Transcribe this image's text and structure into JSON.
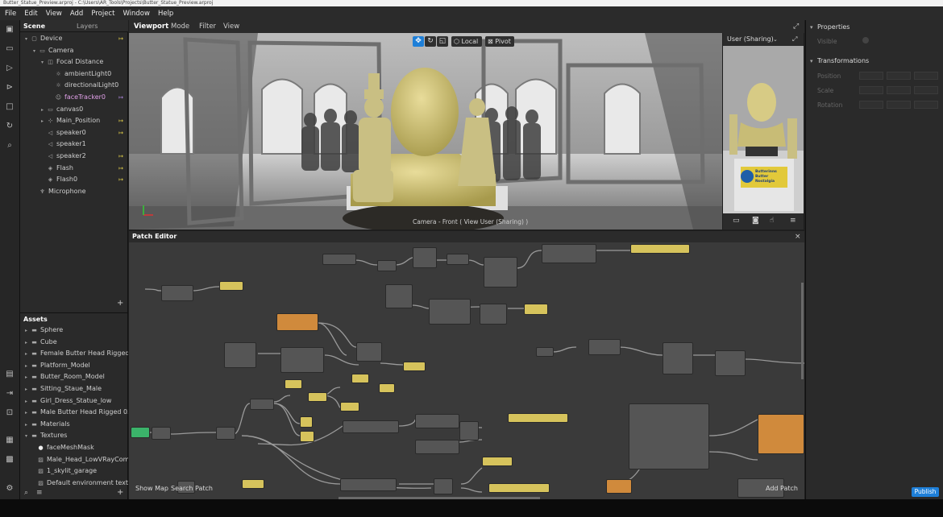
{
  "title_bar": "Butter_Statue_Preview.arproj - C:\\Users\\AR_Tools\\Projects\\Butter_Statue_Preview.arproj",
  "menu": [
    "File",
    "Edit",
    "View",
    "Add",
    "Project",
    "Window",
    "Help"
  ],
  "scene": {
    "tabs": [
      "Scene",
      "Layers"
    ],
    "items": [
      {
        "label": "Device",
        "indent": 0,
        "caret": "▾",
        "icon": "▢",
        "flag": "↦"
      },
      {
        "label": "Camera",
        "indent": 1,
        "caret": "▾",
        "icon": "▭",
        "flag": ""
      },
      {
        "label": "Focal Distance",
        "indent": 2,
        "caret": "▾",
        "icon": "◫",
        "flag": ""
      },
      {
        "label": "ambientLight0",
        "indent": 3,
        "caret": "",
        "icon": "☼",
        "flag": ""
      },
      {
        "label": "directionalLight0",
        "indent": 3,
        "caret": "",
        "icon": "☼",
        "flag": ""
      },
      {
        "label": "faceTracker0",
        "indent": 3,
        "caret": "",
        "icon": "☺",
        "flag": "↦"
      },
      {
        "label": "canvas0",
        "indent": 2,
        "caret": "▸",
        "icon": "▭",
        "flag": ""
      },
      {
        "label": "Main_Position",
        "indent": 2,
        "caret": "▸",
        "icon": "⊹",
        "flag": "↦"
      },
      {
        "label": "speaker0",
        "indent": 2,
        "caret": "",
        "icon": "◁",
        "flag": "↦"
      },
      {
        "label": "speaker1",
        "indent": 2,
        "caret": "",
        "icon": "◁",
        "flag": ""
      },
      {
        "label": "speaker2",
        "indent": 2,
        "caret": "",
        "icon": "◁",
        "flag": "↦"
      },
      {
        "label": "Flash",
        "indent": 2,
        "caret": "",
        "icon": "◈",
        "flag": "↦"
      },
      {
        "label": "Flash0",
        "indent": 2,
        "caret": "",
        "icon": "◈",
        "flag": "↦"
      },
      {
        "label": "Microphone",
        "indent": 1,
        "caret": "",
        "icon": "♆",
        "flag": ""
      }
    ],
    "add_symbol": "+"
  },
  "assets": {
    "header": "Assets",
    "items": [
      {
        "label": "Sphere",
        "indent": 0,
        "caret": "▸",
        "icon": "▬"
      },
      {
        "label": "Cube",
        "indent": 0,
        "caret": "▸",
        "icon": "▬"
      },
      {
        "label": "Female Butter Head Rigged...",
        "indent": 0,
        "caret": "▸",
        "icon": "▬"
      },
      {
        "label": "Platform_Model",
        "indent": 0,
        "caret": "▸",
        "icon": "▬"
      },
      {
        "label": "Butter_Room_Model",
        "indent": 0,
        "caret": "▸",
        "icon": "▬"
      },
      {
        "label": "Sitting_Staue_Male",
        "indent": 0,
        "caret": "▸",
        "icon": "▬"
      },
      {
        "label": "Girl_Dress_Statue_low",
        "indent": 0,
        "caret": "▸",
        "icon": "▬"
      },
      {
        "label": "Male Butter Head Rigged 03",
        "indent": 0,
        "caret": "▸",
        "icon": "▬"
      },
      {
        "label": "Materials",
        "indent": 0,
        "caret": "▸",
        "icon": ""
      },
      {
        "label": "Textures",
        "indent": 0,
        "caret": "▾",
        "icon": ""
      },
      {
        "label": "faceMeshMask",
        "indent": 1,
        "caret": "",
        "icon": "●"
      },
      {
        "label": "Male_Head_LowVRayCom...",
        "indent": 1,
        "caret": "",
        "icon": "▨"
      },
      {
        "label": "1_skylit_garage",
        "indent": 1,
        "caret": "",
        "icon": "▨"
      },
      {
        "label": "Default environment textu...",
        "indent": 1,
        "caret": "",
        "icon": "▨"
      }
    ]
  },
  "viewport": {
    "tabs": [
      "Viewport",
      "Mode",
      "Filter",
      "View"
    ],
    "tools": {
      "local": "Local",
      "pivot": "Pivot"
    },
    "camera_label": "Camera - Front ( View User (Sharing) )",
    "preview_label": "User (Sharing)",
    "sign_text": "Butterinns Butter Nostalgia"
  },
  "patch_editor": {
    "title": "Patch Editor",
    "close": "×",
    "show_map": "Show Map",
    "search_patch": "Search Patch",
    "add_patch": "Add Patch"
  },
  "properties": {
    "header": "Properties",
    "visible_label": "Visible",
    "transformations_header": "Transformations",
    "rows": [
      "Position",
      "Scale",
      "Rotation"
    ]
  },
  "publish_label": "Publish",
  "colors": {
    "accent": "#1e7fd8",
    "patch_yellow": "#d6c35c",
    "patch_orange": "#d08a3c",
    "patch_green": "#3bb36a"
  }
}
